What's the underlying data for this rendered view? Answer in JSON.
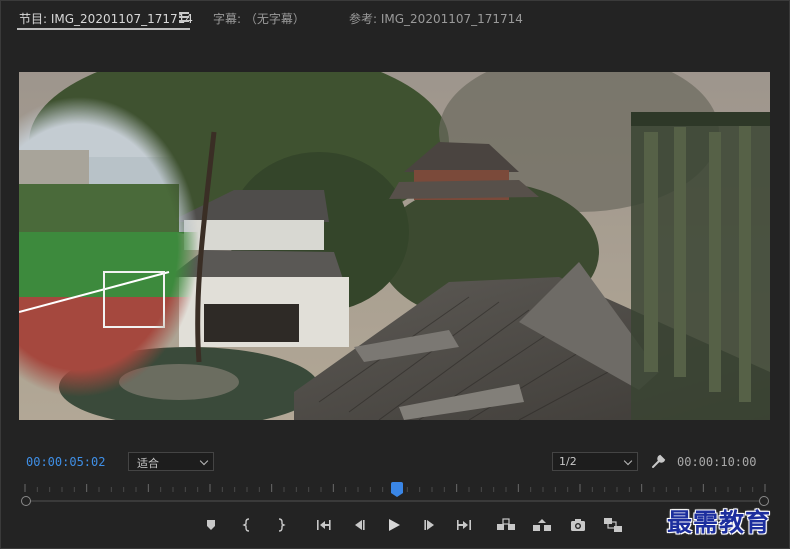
{
  "tabs": [
    {
      "label": "节目: IMG_20201107_171714",
      "active": true
    },
    {
      "label": "字幕: （无字幕）",
      "active": false
    },
    {
      "label": "参考: IMG_20201107_171714",
      "active": false
    }
  ],
  "playback": {
    "current_timecode": "00:00:05:02",
    "duration_timecode": "00:00:10:00",
    "zoom_value": "适合",
    "resolution_value": "1/2"
  },
  "icons": {
    "panel_menu": "hamburger-menu-icon",
    "settings": "wrench-icon",
    "transport": [
      "add-marker-icon",
      "mark-in-icon",
      "mark-out-icon",
      "go-to-in-icon",
      "step-back-icon",
      "play-icon",
      "step-forward-icon",
      "go-to-out-icon",
      "lift-icon",
      "extract-icon",
      "export-frame-icon",
      "insert-icon"
    ]
  },
  "colors": {
    "accent_blue": "#3f8fe6",
    "background": "#232323",
    "watermark": "#1c2e9e"
  },
  "watermark": "最需教育"
}
